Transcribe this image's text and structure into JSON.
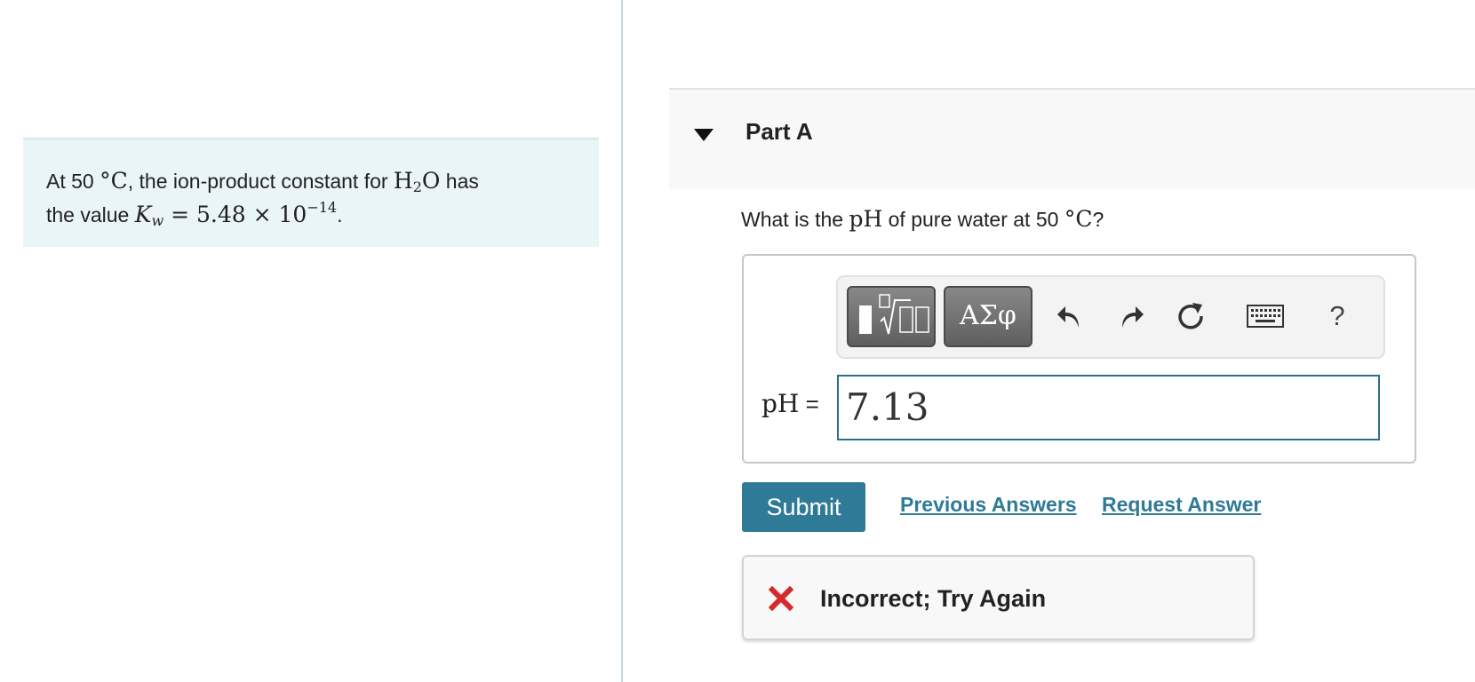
{
  "intro": {
    "prefix": "At 50 ",
    "temp_unit": "°C",
    "mid": ", the ion-product constant for ",
    "formula_h": "H",
    "formula_sub": "2",
    "formula_o": "O",
    "suffix": " has",
    "line2_prefix": "the value ",
    "kw_symbol": "K",
    "kw_sub": "w",
    "kw_value": " = 5.48 × 10",
    "kw_exp": "−14",
    "end": "."
  },
  "part": {
    "title": "Part A"
  },
  "question": {
    "prefix": "What is the ",
    "ph": "pH",
    "mid": " of pure water at 50 ",
    "temp_unit": "°C",
    "end": "?"
  },
  "toolbar": {
    "greek_label": "ΑΣφ",
    "help_label": "?"
  },
  "answer": {
    "label": "pH",
    "equals": " =",
    "value": "7.13"
  },
  "actions": {
    "submit_label": "Submit",
    "previous_answers_label": "Previous Answers",
    "request_answer_label": "Request Answer"
  },
  "feedback": {
    "text": "Incorrect; Try Again"
  },
  "colors": {
    "accent": "#2f7a96",
    "intro_bg": "#e9f5f7",
    "error": "#d62a2a"
  }
}
